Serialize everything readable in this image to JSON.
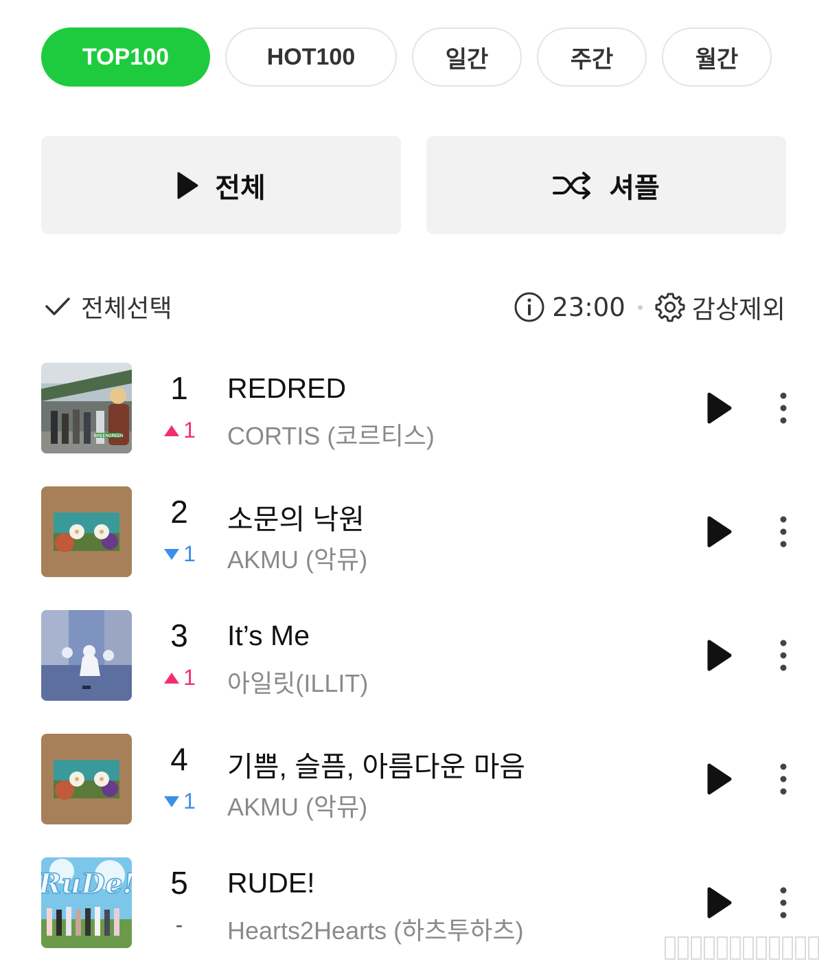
{
  "tabs": [
    {
      "label": "TOP100",
      "active": true
    },
    {
      "label": "HOT100",
      "active": false
    },
    {
      "label": "일간",
      "active": false
    },
    {
      "label": "주간",
      "active": false
    },
    {
      "label": "월간",
      "active": false
    }
  ],
  "actions": {
    "play_all_label": "전체",
    "shuffle_label": "셔플"
  },
  "list_header": {
    "select_all_label": "전체선택",
    "update_time": "23:00",
    "exclude_label": "감상제외"
  },
  "colors": {
    "accent_green": "#1ecb3e",
    "rank_up": "#f0306e",
    "rank_down": "#3b8fe8"
  },
  "chart": [
    {
      "rank": "1",
      "change_dir": "up",
      "change": "1",
      "title": "REDRED",
      "artist": "CORTIS (코르티스)",
      "art_text": "GREENGREEN"
    },
    {
      "rank": "2",
      "change_dir": "down",
      "change": "1",
      "title": "소문의 낙원",
      "artist": "AKMU (악뮤)"
    },
    {
      "rank": "3",
      "change_dir": "up",
      "change": "1",
      "title": "It’s Me",
      "artist": "아일릿(ILLIT)"
    },
    {
      "rank": "4",
      "change_dir": "down",
      "change": "1",
      "title": "기쁨, 슬픔, 아름다운 마음",
      "artist": "AKMU (악뮤)"
    },
    {
      "rank": "5",
      "change_dir": "same",
      "change": "-",
      "title": "RUDE!",
      "artist": "Hearts2Hearts (하츠투하츠)",
      "art_text": "RuDe!"
    }
  ]
}
